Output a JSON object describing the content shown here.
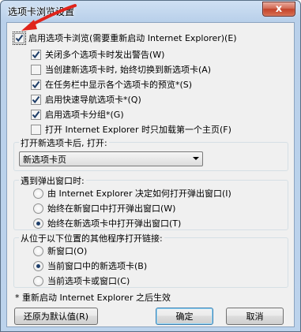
{
  "window": {
    "title": "选项卡浏览设置",
    "close_glyph": "x"
  },
  "master": {
    "label": "启用选项卡浏览(需要重新启动 Internet Explorer)(E)",
    "checked": true
  },
  "options": [
    {
      "label": "关闭多个选项卡时发出警告(W)",
      "checked": true
    },
    {
      "label": "当创建新选项卡时, 始终切换到新选项卡(A)",
      "checked": false
    },
    {
      "label": "在任务栏中显示各个选项卡的预览*(S)",
      "checked": true
    },
    {
      "label": "启用快速导航选项卡*(Q)",
      "checked": true
    },
    {
      "label": "启用选项卡分组*(G)",
      "checked": true
    },
    {
      "label": "打开 Internet Explorer 时只加载第一个主页(F)",
      "checked": false
    }
  ],
  "new_tab": {
    "label": "打开新选项卡后, 打开:",
    "selected": "新选项卡页"
  },
  "popups": {
    "title": "遇到弹出窗口时:",
    "options": [
      {
        "label": "由 Internet Explorer 决定如何打开弹出窗口(I)",
        "selected": false
      },
      {
        "label": "始终在新窗口中打开弹出窗口(W)",
        "selected": false
      },
      {
        "label": "始终在新选项卡中打开弹出窗口(T)",
        "selected": true
      }
    ]
  },
  "links": {
    "title": "从位于以下位置的其他程序打开链接:",
    "options": [
      {
        "label": "新窗口(O)",
        "selected": false
      },
      {
        "label": "当前窗口中的新选项卡(B)",
        "selected": true
      },
      {
        "label": "当前选项卡或窗口(C)",
        "selected": false
      }
    ]
  },
  "note": "* 重新启动 Internet Explorer 之后生效",
  "buttons": {
    "restore": "还原为默认值(R)",
    "ok": "确定",
    "cancel": "取消"
  },
  "colors": {
    "annotation_arrow": "#e0241b",
    "checkmark": "#1f3e68"
  }
}
